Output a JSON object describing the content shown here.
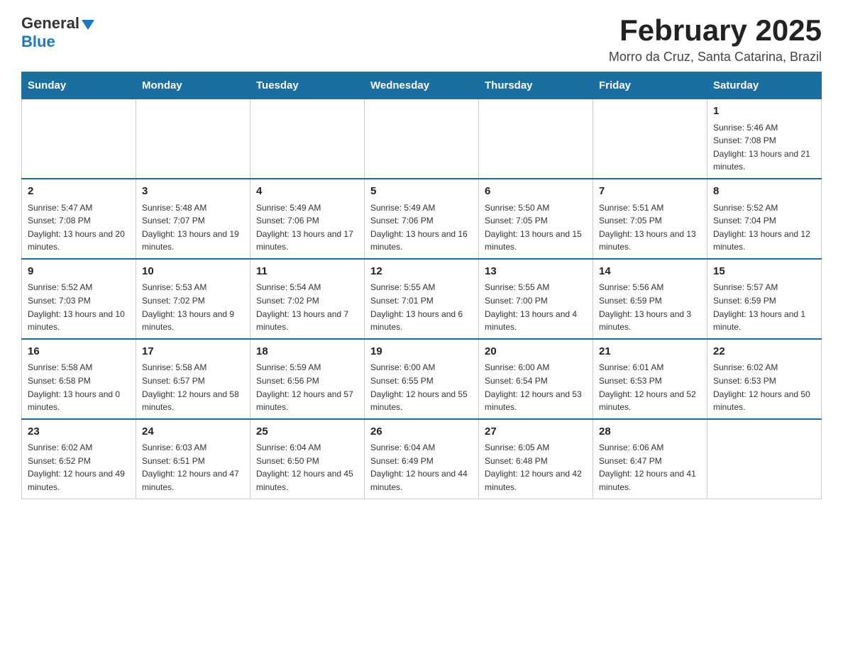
{
  "header": {
    "logo_general": "General",
    "logo_blue": "Blue",
    "title": "February 2025",
    "location": "Morro da Cruz, Santa Catarina, Brazil"
  },
  "days_of_week": [
    "Sunday",
    "Monday",
    "Tuesday",
    "Wednesday",
    "Thursday",
    "Friday",
    "Saturday"
  ],
  "weeks": [
    {
      "days": [
        {
          "date": "",
          "info": ""
        },
        {
          "date": "",
          "info": ""
        },
        {
          "date": "",
          "info": ""
        },
        {
          "date": "",
          "info": ""
        },
        {
          "date": "",
          "info": ""
        },
        {
          "date": "",
          "info": ""
        },
        {
          "date": "1",
          "info": "Sunrise: 5:46 AM\nSunset: 7:08 PM\nDaylight: 13 hours and 21 minutes."
        }
      ]
    },
    {
      "days": [
        {
          "date": "2",
          "info": "Sunrise: 5:47 AM\nSunset: 7:08 PM\nDaylight: 13 hours and 20 minutes."
        },
        {
          "date": "3",
          "info": "Sunrise: 5:48 AM\nSunset: 7:07 PM\nDaylight: 13 hours and 19 minutes."
        },
        {
          "date": "4",
          "info": "Sunrise: 5:49 AM\nSunset: 7:06 PM\nDaylight: 13 hours and 17 minutes."
        },
        {
          "date": "5",
          "info": "Sunrise: 5:49 AM\nSunset: 7:06 PM\nDaylight: 13 hours and 16 minutes."
        },
        {
          "date": "6",
          "info": "Sunrise: 5:50 AM\nSunset: 7:05 PM\nDaylight: 13 hours and 15 minutes."
        },
        {
          "date": "7",
          "info": "Sunrise: 5:51 AM\nSunset: 7:05 PM\nDaylight: 13 hours and 13 minutes."
        },
        {
          "date": "8",
          "info": "Sunrise: 5:52 AM\nSunset: 7:04 PM\nDaylight: 13 hours and 12 minutes."
        }
      ]
    },
    {
      "days": [
        {
          "date": "9",
          "info": "Sunrise: 5:52 AM\nSunset: 7:03 PM\nDaylight: 13 hours and 10 minutes."
        },
        {
          "date": "10",
          "info": "Sunrise: 5:53 AM\nSunset: 7:02 PM\nDaylight: 13 hours and 9 minutes."
        },
        {
          "date": "11",
          "info": "Sunrise: 5:54 AM\nSunset: 7:02 PM\nDaylight: 13 hours and 7 minutes."
        },
        {
          "date": "12",
          "info": "Sunrise: 5:55 AM\nSunset: 7:01 PM\nDaylight: 13 hours and 6 minutes."
        },
        {
          "date": "13",
          "info": "Sunrise: 5:55 AM\nSunset: 7:00 PM\nDaylight: 13 hours and 4 minutes."
        },
        {
          "date": "14",
          "info": "Sunrise: 5:56 AM\nSunset: 6:59 PM\nDaylight: 13 hours and 3 minutes."
        },
        {
          "date": "15",
          "info": "Sunrise: 5:57 AM\nSunset: 6:59 PM\nDaylight: 13 hours and 1 minute."
        }
      ]
    },
    {
      "days": [
        {
          "date": "16",
          "info": "Sunrise: 5:58 AM\nSunset: 6:58 PM\nDaylight: 13 hours and 0 minutes."
        },
        {
          "date": "17",
          "info": "Sunrise: 5:58 AM\nSunset: 6:57 PM\nDaylight: 12 hours and 58 minutes."
        },
        {
          "date": "18",
          "info": "Sunrise: 5:59 AM\nSunset: 6:56 PM\nDaylight: 12 hours and 57 minutes."
        },
        {
          "date": "19",
          "info": "Sunrise: 6:00 AM\nSunset: 6:55 PM\nDaylight: 12 hours and 55 minutes."
        },
        {
          "date": "20",
          "info": "Sunrise: 6:00 AM\nSunset: 6:54 PM\nDaylight: 12 hours and 53 minutes."
        },
        {
          "date": "21",
          "info": "Sunrise: 6:01 AM\nSunset: 6:53 PM\nDaylight: 12 hours and 52 minutes."
        },
        {
          "date": "22",
          "info": "Sunrise: 6:02 AM\nSunset: 6:53 PM\nDaylight: 12 hours and 50 minutes."
        }
      ]
    },
    {
      "days": [
        {
          "date": "23",
          "info": "Sunrise: 6:02 AM\nSunset: 6:52 PM\nDaylight: 12 hours and 49 minutes."
        },
        {
          "date": "24",
          "info": "Sunrise: 6:03 AM\nSunset: 6:51 PM\nDaylight: 12 hours and 47 minutes."
        },
        {
          "date": "25",
          "info": "Sunrise: 6:04 AM\nSunset: 6:50 PM\nDaylight: 12 hours and 45 minutes."
        },
        {
          "date": "26",
          "info": "Sunrise: 6:04 AM\nSunset: 6:49 PM\nDaylight: 12 hours and 44 minutes."
        },
        {
          "date": "27",
          "info": "Sunrise: 6:05 AM\nSunset: 6:48 PM\nDaylight: 12 hours and 42 minutes."
        },
        {
          "date": "28",
          "info": "Sunrise: 6:06 AM\nSunset: 6:47 PM\nDaylight: 12 hours and 41 minutes."
        },
        {
          "date": "",
          "info": ""
        }
      ]
    }
  ]
}
